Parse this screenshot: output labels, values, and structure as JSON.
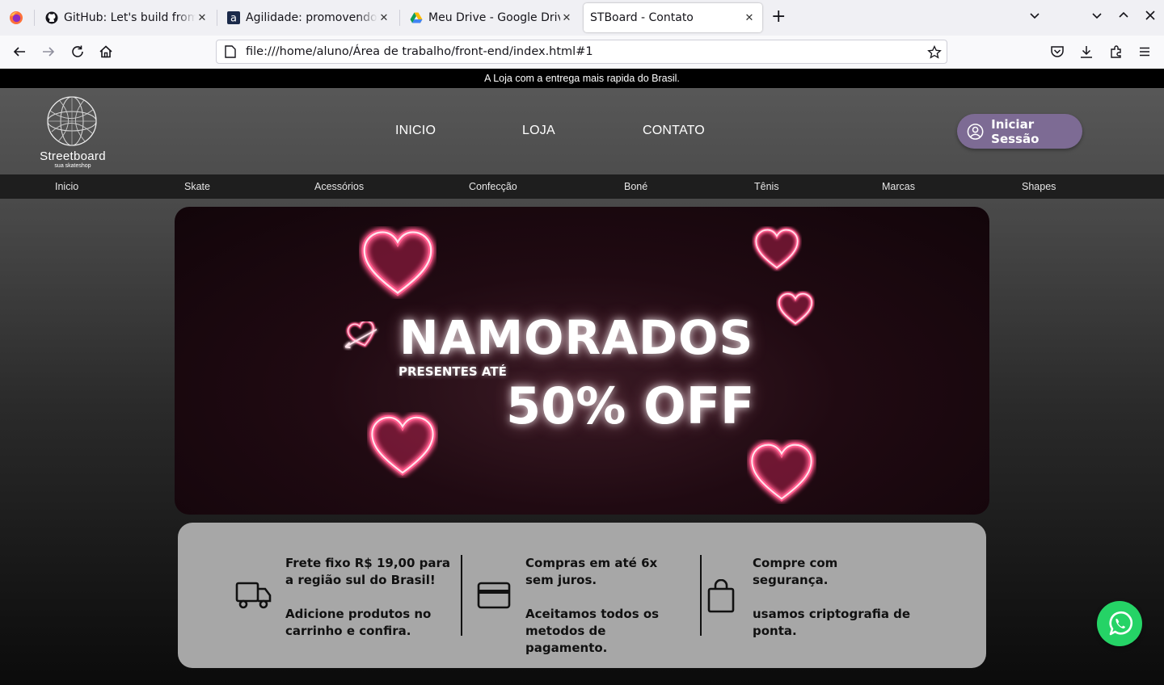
{
  "browser": {
    "tabs": [
      {
        "title": "GitHub: Let's build from here",
        "favicon": "github-icon"
      },
      {
        "title": "Agilidade: promovendo a transformação",
        "favicon": "a-icon"
      },
      {
        "title": "Meu Drive - Google Drive",
        "favicon": "google-drive-icon"
      },
      {
        "title": "STBoard - Contato",
        "favicon": "none",
        "active": true
      }
    ],
    "url": "file:///home/aluno/Área de trabalho/front-end/index.html#1"
  },
  "site": {
    "announcement": "A Loja com a entrega mais rapida do Brasil.",
    "logo": {
      "name": "Streetboard",
      "tagline": "sua skateshop"
    },
    "nav": [
      "INICIO",
      "LOJA",
      "CONTATO"
    ],
    "login_label": "Iniciar Sessão",
    "categories": [
      "Inicio",
      "Skate",
      "Acessórios",
      "Confecção",
      "Boné",
      "Tênis",
      "Marcas",
      "Shapes"
    ],
    "banner": {
      "title": "NAMORADOS",
      "subtitle": "PRESENTES ATÉ",
      "offer": "50% OFF"
    },
    "features": [
      {
        "icon": "truck-icon",
        "line1": "Frete fixo R$ 19,00 para a região sul do Brasil!",
        "line2": "Adicione produtos no carrinho e confira."
      },
      {
        "icon": "credit-card-icon",
        "line1": "Compras em até 6x sem juros.",
        "line2": "Aceitamos todos os metodos de pagamento."
      },
      {
        "icon": "shopping-bag-icon",
        "line1": "Compre com segurança.",
        "line2": "usamos criptografia de ponta."
      }
    ],
    "whatsapp_icon": "whatsapp-icon"
  },
  "colors": {
    "login_button": "#7d6b94",
    "whatsapp": "#25d366",
    "info_panel": "#a7a7a7",
    "neon_heart": "#ff2e6e"
  }
}
